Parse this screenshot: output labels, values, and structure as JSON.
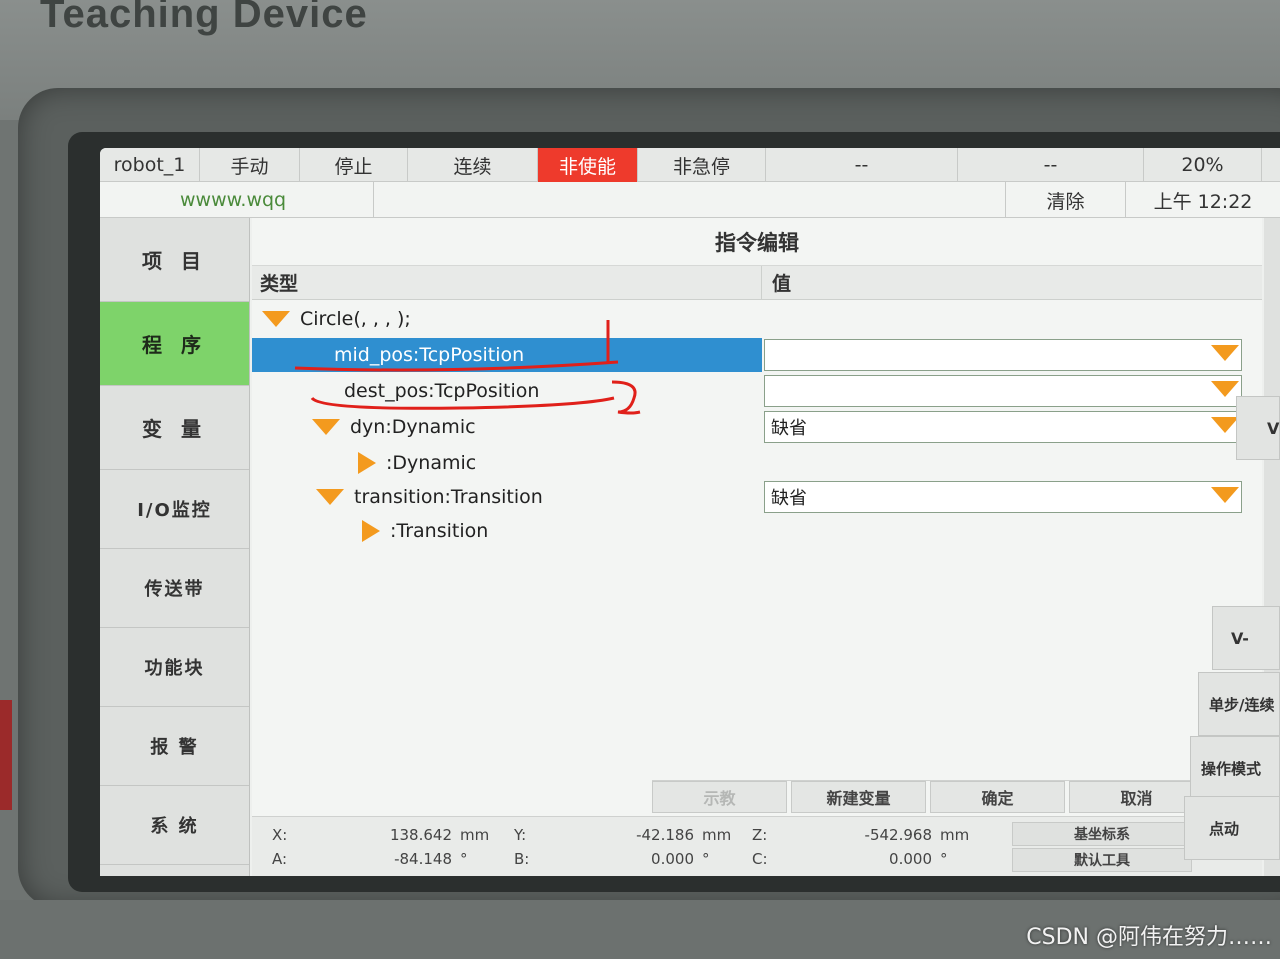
{
  "device": {
    "brand": "Teaching Device",
    "watermark": "CSDN @阿伟在努力……"
  },
  "status_bar": {
    "robot": "robot_1",
    "mode": "手动",
    "run_state": "停止",
    "run_mode": "连续",
    "enable_state": "非使能",
    "estop_state": "非急停",
    "field1": "--",
    "field2": "--",
    "speed": "20%"
  },
  "info_bar": {
    "user": "wwww.wqq",
    "clear_label": "清除",
    "time": "上午 12:22"
  },
  "nav": {
    "items": [
      {
        "label": "项 目"
      },
      {
        "label": "程 序"
      },
      {
        "label": "变 量"
      },
      {
        "label": "I/O监控"
      },
      {
        "label": "传送带"
      },
      {
        "label": "功能块"
      },
      {
        "label": "报 警"
      },
      {
        "label": "系 统"
      }
    ],
    "active_index": 1
  },
  "editor": {
    "title": "指令编辑",
    "col_type": "类型",
    "col_value": "值",
    "rows": [
      {
        "label": "Circle(, , , );"
      },
      {
        "label": "mid_pos:TcpPosition",
        "value": ""
      },
      {
        "label": "dest_pos:TcpPosition",
        "value": ""
      },
      {
        "label": "dyn:Dynamic",
        "value": "缺省"
      },
      {
        "label": ":Dynamic"
      },
      {
        "label": "transition:Transition",
        "value": "缺省"
      },
      {
        "label": ":Transition"
      }
    ]
  },
  "actions": {
    "teach": "示教",
    "new_var": "新建变量",
    "ok": "确定",
    "cancel": "取消"
  },
  "coords": {
    "x_label": "X:",
    "x": "138.642",
    "x_unit": "mm",
    "y_label": "Y:",
    "y": "-42.186",
    "y_unit": "mm",
    "z_label": "Z:",
    "z": "-542.968",
    "z_unit": "mm",
    "a_label": "A:",
    "a": "-84.148",
    "a_unit": "°",
    "b_label": "B:",
    "b": "0.000",
    "b_unit": "°",
    "c_label": "C:",
    "c": "0.000",
    "c_unit": "°",
    "base_frame": "基坐标系",
    "tool_frame": "默认工具"
  },
  "right_panel": {
    "v_plus": "V",
    "v_minus": "V-",
    "step_cont": "单步/连续",
    "op_mode": "操作模式",
    "jog": "点动"
  },
  "colors": {
    "alarm": "#ee3a2c",
    "nav_active": "#7ed36a",
    "selection": "#2f8fd0",
    "tree_arrow": "#f39a1e",
    "annotation": "#e0201a"
  }
}
